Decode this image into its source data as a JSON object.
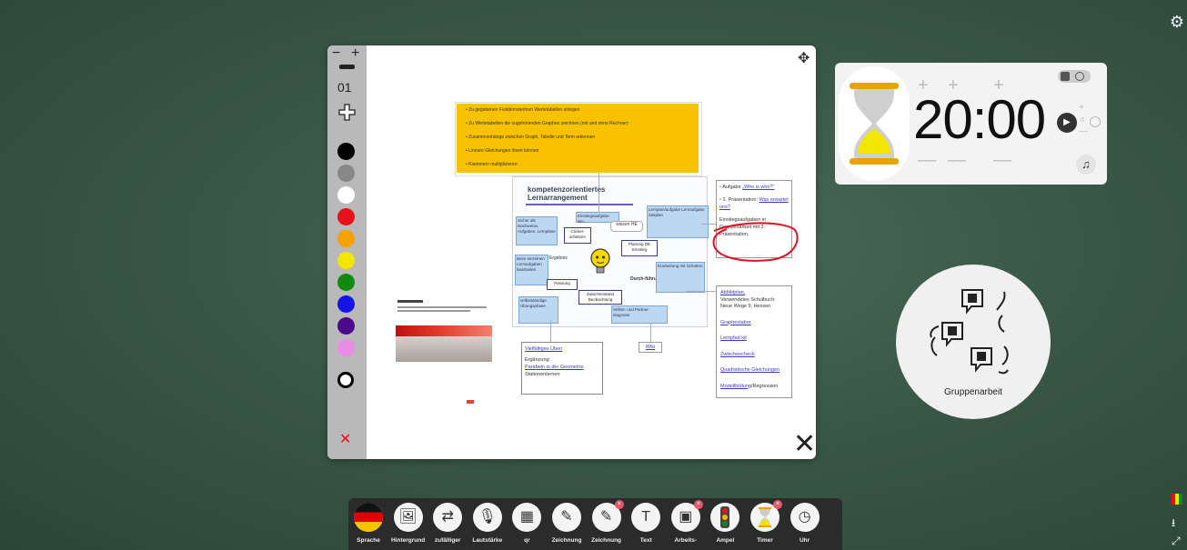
{
  "panel": {
    "zoom_minus": "−",
    "zoom_plus": "+",
    "page_number": "01",
    "colors": [
      "#000000",
      "#888888",
      "#ffffff",
      "#e8101a",
      "#f5a100",
      "#f2e600",
      "#108a10",
      "#1414e6",
      "#4a0a8a",
      "#ea8ce6"
    ],
    "close_red": "✕",
    "close": "✕",
    "move": "✥"
  },
  "worksheet": {
    "yellow_items": [
      "Zu gegebenen Funktionstermen Wertetabellen anlegen",
      "Zu Wertetabellen die zugehörenden Graphen zeichnen (mit und ohne Rechner)",
      "Zusammenhänge zwischen Graph, Tabelle und Term erkennen",
      "Lineare Gleichungen lösen können",
      "Klammern multiplizieren"
    ],
    "title_line1": "kompetenzorientiertes",
    "title_line2": "Lernarrangement",
    "nodes": {
      "einstieg": "Einstiegsaufgabe: Wo...",
      "clicker": "Clicker-schätzen",
      "sicher": "Sicher als Nachweise, Aufgaben, Lernpläne",
      "wissenHE": "wissen HE",
      "planung": "Planung DE Einstieg",
      "lernplan": "Lernplan/aufgabe Lernaufgabe Zeitplan",
      "ergebnis": "Ergebnis",
      "bearbeit": "Beim einzelnen Lernaufgaben bearbeiten",
      "durch": "Durch-führung",
      "erarbeitung": "Erarbeitung mit Schülern",
      "pessimy": "Passung",
      "zwischen": "Zwischenstand Beobachtung",
      "selbst": "selbstständige Übungsphase",
      "partner": "Selbst- und Partner-diagnose"
    },
    "right_box": {
      "item1_prefix": "Aufgabe ",
      "item1_link": "„Who is who?“",
      "item2_prefix": "1. Präsentation: ",
      "item2_link": "Was erwartet uns?",
      "item3": "Einstiegsaufgaben in Gruppenarbeit mit 3. Präsentation."
    },
    "resources": {
      "line1_link": "Abbildplan,",
      "line2": "Verwendetes Schulbuch:",
      "line3": "Neue Wege 9, Hessen",
      "links": [
        "Graphenlabor",
        "Lernpfad kit",
        "Zwischencheck",
        "Quadratische Gleichungen"
      ],
      "last_link": "Modellbildung",
      "last_tail": "/Regression"
    },
    "vielf": {
      "link": "Vielfältiges Üben",
      "line2": "Ergänzung:",
      "line3_link": "Parabeln in der Geometrie",
      "line4": "Stationenlernen"
    },
    "small_link": "Wiki"
  },
  "timer": {
    "time": "20:00",
    "plus": "+",
    "minus": "—",
    "side_num": "0",
    "play": "▶"
  },
  "group": {
    "label": "Gruppenarbeit"
  },
  "dock": {
    "items": [
      {
        "label": "Sprache",
        "icon": "flag-icon",
        "badge": ""
      },
      {
        "label": "Hintergrund",
        "icon": "image-icon",
        "badge": ""
      },
      {
        "label": "zufälliger",
        "icon": "random-names-icon",
        "badge": ""
      },
      {
        "label": "Lautstärke",
        "icon": "microphone-icon",
        "badge": ""
      },
      {
        "label": "qr",
        "icon": "qr-code-icon",
        "badge": ""
      },
      {
        "label": "Zeichnung",
        "icon": "pencil-icon",
        "badge": ""
      },
      {
        "label": "Zeichnung",
        "icon": "pencil-icon",
        "badge": "×"
      },
      {
        "label": "Text",
        "icon": "text-icon",
        "badge": ""
      },
      {
        "label": "Arbeits-",
        "icon": "worksymbol-icon",
        "badge": "×"
      },
      {
        "label": "Ampel",
        "icon": "traffic-light-icon",
        "badge": ""
      },
      {
        "label": "Timer",
        "icon": "hourglass-icon",
        "badge": "×"
      },
      {
        "label": "Uhr",
        "icon": "clock-icon",
        "badge": ""
      }
    ]
  }
}
